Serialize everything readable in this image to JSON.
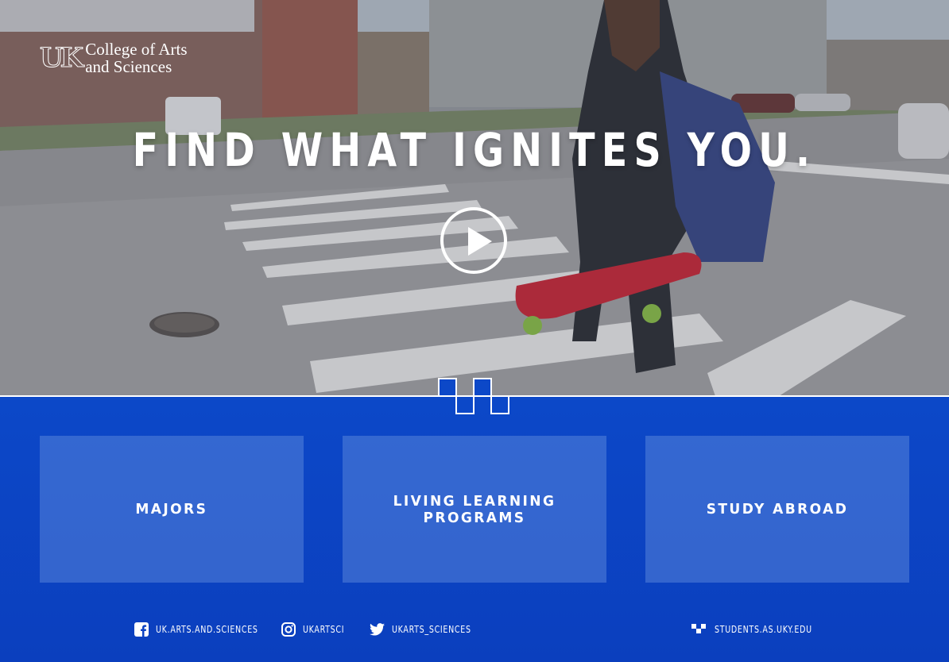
{
  "brand": {
    "mark": "UK",
    "line1": "College of Arts",
    "line2": "and Sciences"
  },
  "hero": {
    "headline": "FIND WHAT IGNITES YOU.",
    "play_icon": "play-icon"
  },
  "cards": [
    {
      "label": "MAJORS"
    },
    {
      "label": "LIVING LEARNING PROGRAMS"
    },
    {
      "label": "STUDY ABROAD"
    }
  ],
  "footer": {
    "links": [
      {
        "icon": "facebook-icon",
        "label": "UK.ARTS.AND.SCIENCES"
      },
      {
        "icon": "instagram-icon",
        "label": "UKARTSCI"
      },
      {
        "icon": "twitter-icon",
        "label": "UKARTS_SCIENCES"
      },
      {
        "icon": "site-logo-icon",
        "label": "STUDENTS.AS.UKY.EDU"
      }
    ]
  },
  "colors": {
    "brand_blue": "#0b42c4",
    "card_fill": "#6e96e1",
    "text": "#ffffff"
  }
}
